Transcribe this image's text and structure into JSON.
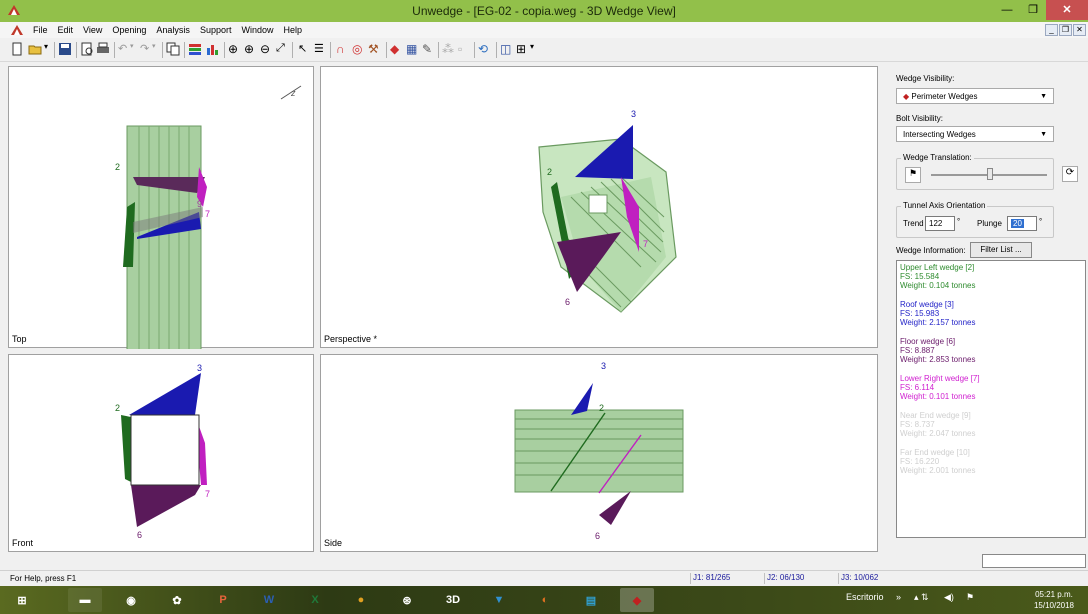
{
  "window": {
    "title": "Unwedge - [EG-02 - copia.weg - 3D Wedge View]"
  },
  "menu": {
    "items": [
      "File",
      "Edit",
      "View",
      "Opening",
      "Analysis",
      "Support",
      "Window",
      "Help"
    ]
  },
  "views": {
    "top": {
      "label": "Top"
    },
    "perspective": {
      "label": "Perspective *"
    },
    "front": {
      "label": "Front"
    },
    "side": {
      "label": "Side"
    }
  },
  "wedge_numbers": {
    "w2": "2",
    "w3": "3",
    "w6": "6",
    "w7": "7",
    "w9": "9"
  },
  "panel": {
    "wedge_visibility_label": "Wedge Visibility:",
    "wedge_visibility_value": "Perimeter Wedges",
    "bolt_visibility_label": "Bolt Visibility:",
    "bolt_visibility_value": "Intersecting Wedges",
    "wedge_translation_label": "Wedge Translation:",
    "tunnel_axis_label": "Tunnel Axis Orientation",
    "trend_label": "Trend",
    "trend_value": "122",
    "plunge_label": "Plunge",
    "plunge_value": "20",
    "degree": "°",
    "wedge_info_label": "Wedge Information:",
    "filter_button": "Filter List ..."
  },
  "wedges": [
    {
      "name": "Upper Left wedge [2]",
      "fs": "FS: 15.584",
      "weight": "Weight: 0.104 tonnes",
      "color": "#2e8b2e"
    },
    {
      "name": "Roof wedge [3]",
      "fs": "FS: 15.983",
      "weight": "Weight: 2.157 tonnes",
      "color": "#2323c8"
    },
    {
      "name": "Floor wedge [6]",
      "fs": "FS: 8.887",
      "weight": "Weight: 2.853 tonnes",
      "color": "#6a1a6a"
    },
    {
      "name": "Lower Right wedge [7]",
      "fs": "FS: 6.114",
      "weight": "Weight: 0.101 tonnes",
      "color": "#d020d0"
    },
    {
      "name": "Near End wedge [9]",
      "fs": "FS: 8.737",
      "weight": "Weight: 2.047 tonnes",
      "color": "#d0d0d0"
    },
    {
      "name": "Far End wedge [10]",
      "fs": "FS: 16.220",
      "weight": "Weight: 2.001 tonnes",
      "color": "#d0d0d0"
    }
  ],
  "status": {
    "help": "For Help, press F1",
    "j1": "J1: 81/265",
    "j2": "J2: 06/130",
    "j3": "J3: 10/062"
  },
  "taskbar": {
    "escritorio": "Escritorio",
    "time": "05:21 p.m.",
    "date": "15/10/2018"
  }
}
